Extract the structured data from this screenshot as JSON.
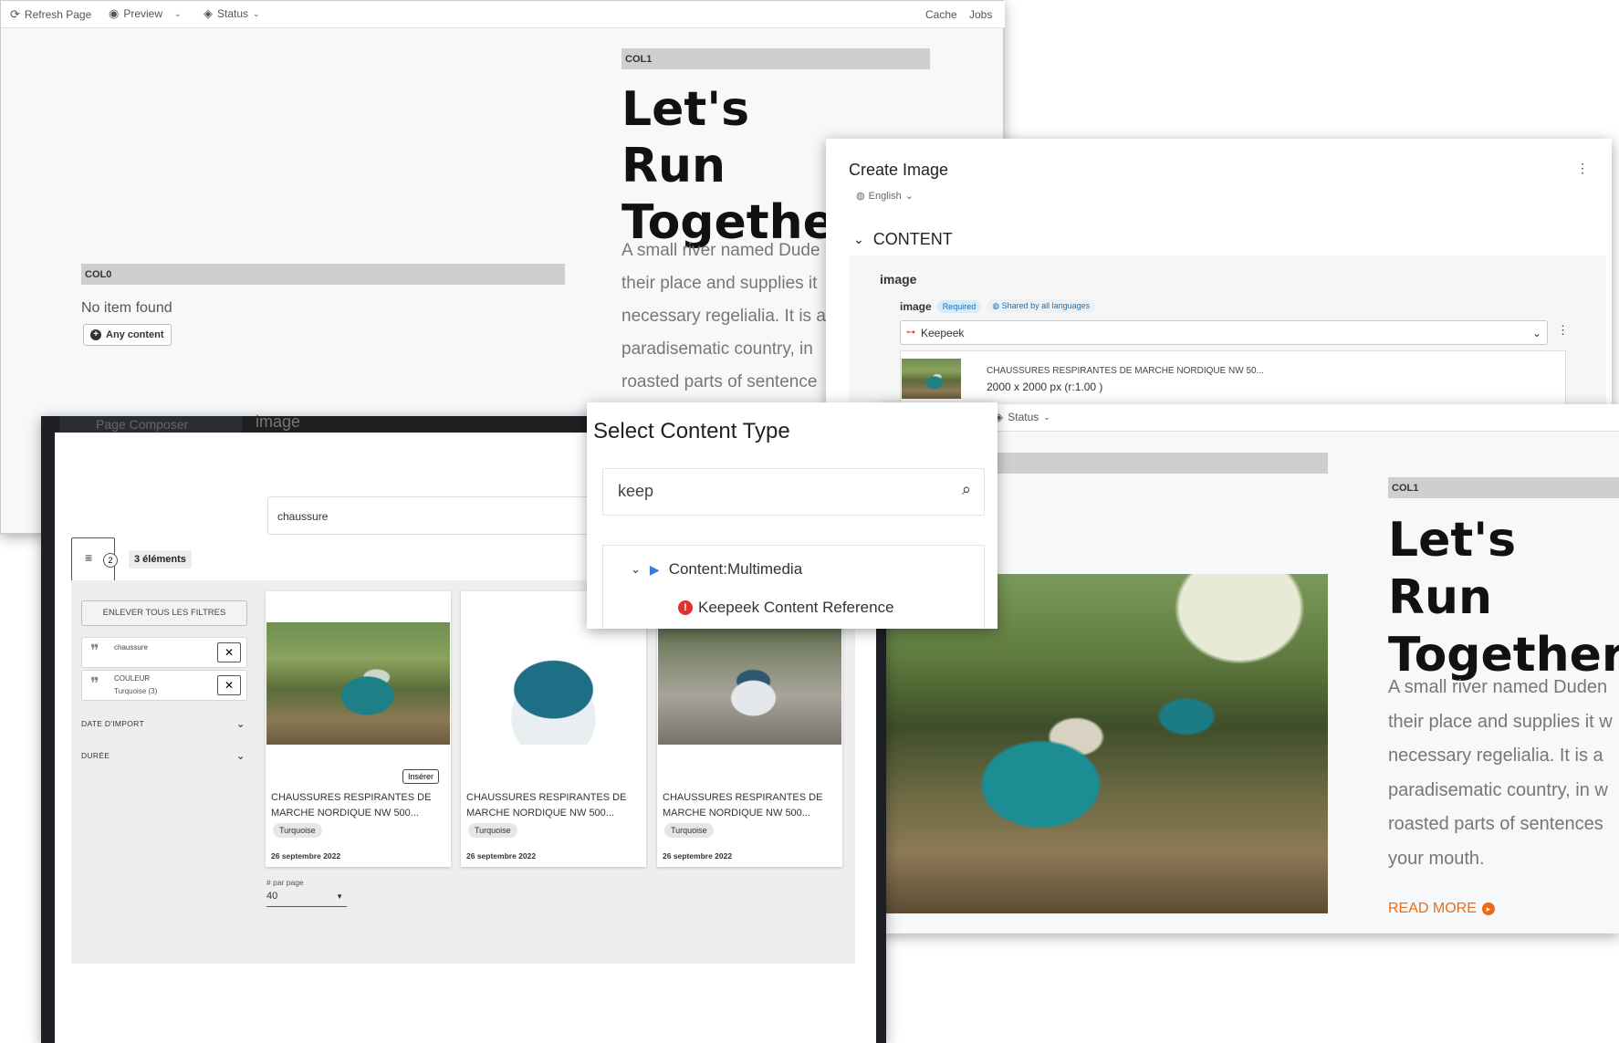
{
  "toolbar": {
    "refresh": "Refresh Page",
    "preview": "Preview",
    "status": "Status",
    "cache": "Cache",
    "jobs": "Jobs"
  },
  "page_back": {
    "col1_label": "COL1",
    "heading": "Let's Run Together",
    "paragraph_lines": [
      "A small river named Dude",
      "their place and supplies it",
      "necessary regelialia. It is a",
      "paradisematic country, in",
      "roasted parts of sentence"
    ],
    "col0_label": "COL0",
    "no_item": "No item found",
    "any_content": "Any content"
  },
  "create_image": {
    "title": "Create Image",
    "language": "English",
    "section": "CONTENT",
    "group": "image",
    "field_label": "image",
    "required": "Required",
    "shared": "Shared by all languages",
    "provider": "Keepeek",
    "asset_title": "CHAUSSURES RESPIRANTES DE MARCHE NORDIQUE NW 50...",
    "asset_size": "2000 x 2000 px (r:1.00 )"
  },
  "page_front": {
    "status": "Status",
    "col1_label": "COL1",
    "heading": "Let's Run Together",
    "paragraph_lines": [
      "A small river named Duden",
      "their place and supplies it w",
      "necessary regelialia. It is a",
      "paradisematic country, in w",
      "roasted parts of sentences",
      "your mouth."
    ],
    "read_more": "READ MORE"
  },
  "select_type": {
    "title": "Select Content Type",
    "search_value": "keep",
    "tree_parent": "Content:Multimedia",
    "tree_child": "Keepeek Content Reference"
  },
  "dam": {
    "tab_composer": "Page Composer",
    "tab_image": "image",
    "search_value": "chaussure",
    "filter_count": "2",
    "results_count": "3 éléments",
    "clear_filters": "ENLEVER TOUS LES FILTRES",
    "filters": [
      {
        "title": "chaussure",
        "sub": ""
      },
      {
        "title": "COULEUR",
        "sub": "Turquoise (3)"
      }
    ],
    "facets": [
      "DATE D'IMPORT",
      "DURÉE"
    ],
    "insert": "Insérer",
    "cards": [
      {
        "title": "CHAUSSURES RESPIRANTES DE MARCHE NORDIQUE NW 500...",
        "tag": "Turquoise",
        "date": "26 septembre 2022"
      },
      {
        "title": "CHAUSSURES RESPIRANTES DE MARCHE NORDIQUE NW 500...",
        "tag": "Turquoise",
        "date": "26 septembre 2022"
      },
      {
        "title": "CHAUSSURES RESPIRANTES DE MARCHE NORDIQUE NW 500...",
        "tag": "Turquoise",
        "date": "26 septembre 2022"
      }
    ],
    "per_page_label": "# par page",
    "per_page_value": "40"
  }
}
